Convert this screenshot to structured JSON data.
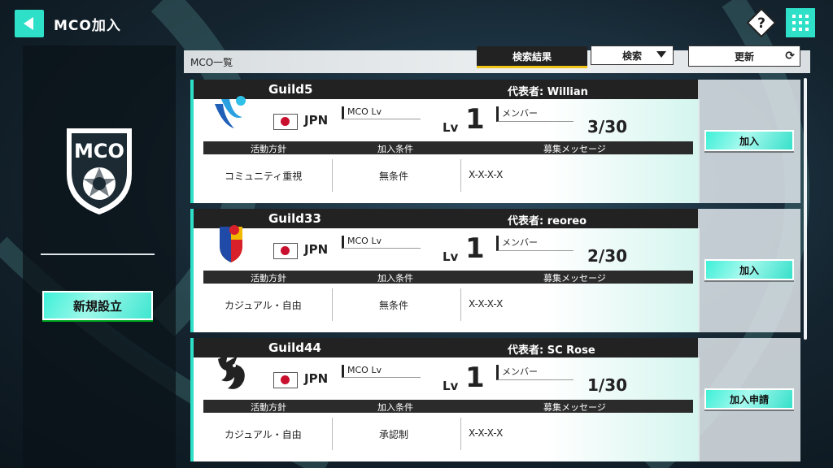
{
  "header": {
    "title": "MCO加入"
  },
  "left_panel": {
    "logo_text": "MCO",
    "new_button": "新規設立"
  },
  "list": {
    "title": "MCO一覧",
    "tab_result": "検索結果",
    "search_button": "検索",
    "update_button": "更新"
  },
  "labels": {
    "mco_lv": "MCO Lv",
    "lv_prefix": "Lv",
    "member": "メンバー",
    "col_policy": "活動方針",
    "col_condition": "加入条件",
    "col_message": "募集メッセージ"
  },
  "guilds": [
    {
      "name": "Guild5",
      "rep": "代表者: Willian",
      "country": "JPN",
      "level": "1",
      "members": "3/30",
      "policy": "コミュニティ重視",
      "condition": "無条件",
      "message": "X-X-X-X",
      "action": "加入"
    },
    {
      "name": "Guild33",
      "rep": "代表者: reoreo",
      "country": "JPN",
      "level": "1",
      "members": "2/30",
      "policy": "カジュアル・自由",
      "condition": "無条件",
      "message": "X-X-X-X",
      "action": "加入"
    },
    {
      "name": "Guild44",
      "rep": "代表者: SC Rose",
      "country": "JPN",
      "level": "1",
      "members": "1/30",
      "policy": "カジュアル・自由",
      "condition": "承認制",
      "message": "X-X-X-X",
      "action": "加入申請"
    }
  ],
  "colors": {
    "accent": "#2fe0c8",
    "dark": "#222222"
  }
}
